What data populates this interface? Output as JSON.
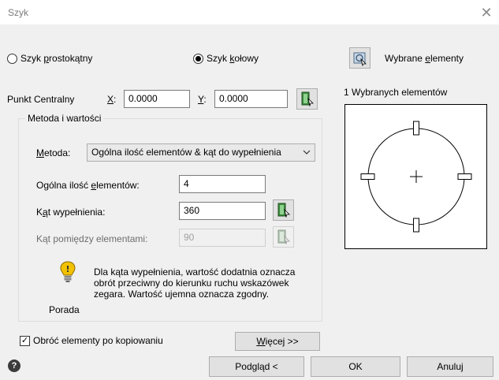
{
  "window": {
    "title": "Szyk",
    "close_glyph": "✕"
  },
  "array_type": {
    "rectangular": {
      "pre": "Szyk ",
      "u": "p",
      "post": "rostokątny",
      "selected": false
    },
    "polar": {
      "pre": "Szyk ",
      "u": "k",
      "post": "ołowy",
      "selected": true
    }
  },
  "select_objects": {
    "label_pre": "Wybrane ",
    "label_u": "e",
    "label_post": "lementy",
    "icon": "select-objects-icon"
  },
  "selected_count_text": "1 Wybranych elementów",
  "center_point": {
    "label": "Punkt Centralny",
    "x_label": "X",
    "x_value": "0.0000",
    "y_label": "Y",
    "y_value": "0.0000",
    "colon": ":"
  },
  "method_group": {
    "title": "Metoda i wartości",
    "method_label_u": "M",
    "method_label_post": "etoda:",
    "method_value": "Ogólna ilość elementów & kąt do wypełnienia",
    "total_items": {
      "label_pre": "Ogólna ilość ",
      "label_u": "e",
      "label_post": "lementów:",
      "value": "4"
    },
    "fill_angle": {
      "label_pre": "K",
      "label_u": "ą",
      "label_post": "t wypełnienia:",
      "value": "360"
    },
    "angle_between": {
      "label": "Kąt pomiędzy elementami:",
      "value": "90"
    },
    "tip": {
      "icon": "lightbulb-icon",
      "caption": "Porada",
      "text": "Dla kąta wypełnienia, wartość dodatnia oznacza obrót przeciwny do kierunku ruchu wskazówek zegara. Wartość ujemna oznacza zgodny."
    }
  },
  "rotate_items": {
    "label": "Obróć elementy po kopiowaniu",
    "checked": true
  },
  "more_button": {
    "u": "W",
    "post": "ięcej >>"
  },
  "footer": {
    "help_icon": "help-icon",
    "preview_label": "Podgląd <",
    "ok_label": "OK",
    "cancel_label": "Anuluj"
  },
  "colors": {
    "client_bg": "#f0f0f0",
    "tip_bulb": "#f2c200"
  }
}
